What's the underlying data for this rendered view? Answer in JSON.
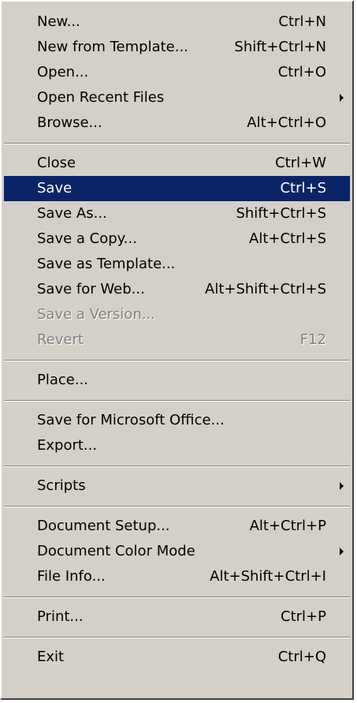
{
  "menu": {
    "groups": [
      [
        {
          "label": "New...",
          "shortcut": "Ctrl+N"
        },
        {
          "label": "New from Template...",
          "shortcut": "Shift+Ctrl+N"
        },
        {
          "label": "Open...",
          "shortcut": "Ctrl+O"
        },
        {
          "label": "Open Recent Files",
          "shortcut": "",
          "submenu": true
        },
        {
          "label": "Browse...",
          "shortcut": "Alt+Ctrl+O"
        }
      ],
      [
        {
          "label": "Close",
          "shortcut": "Ctrl+W"
        },
        {
          "label": "Save",
          "shortcut": "Ctrl+S",
          "selected": true
        },
        {
          "label": "Save As...",
          "shortcut": "Shift+Ctrl+S"
        },
        {
          "label": "Save a Copy...",
          "shortcut": "Alt+Ctrl+S"
        },
        {
          "label": "Save as Template...",
          "shortcut": ""
        },
        {
          "label": "Save for Web...",
          "shortcut": "Alt+Shift+Ctrl+S"
        },
        {
          "label": "Save a Version...",
          "shortcut": "",
          "disabled": true
        },
        {
          "label": "Revert",
          "shortcut": "F12",
          "disabled": true
        }
      ],
      [
        {
          "label": "Place...",
          "shortcut": ""
        }
      ],
      [
        {
          "label": "Save for Microsoft Office...",
          "shortcut": ""
        },
        {
          "label": "Export...",
          "shortcut": ""
        }
      ],
      [
        {
          "label": "Scripts",
          "shortcut": "",
          "submenu": true
        }
      ],
      [
        {
          "label": "Document Setup...",
          "shortcut": "Alt+Ctrl+P"
        },
        {
          "label": "Document Color Mode",
          "shortcut": "",
          "submenu": true
        },
        {
          "label": "File Info...",
          "shortcut": "Alt+Shift+Ctrl+I"
        }
      ],
      [
        {
          "label": "Print...",
          "shortcut": "Ctrl+P"
        }
      ],
      [
        {
          "label": "Exit",
          "shortcut": "Ctrl+Q"
        }
      ]
    ],
    "colors": {
      "background": "#d4d0c8",
      "selected_background": "#0a246a",
      "selected_text": "#ffffff",
      "disabled_text": "#808080"
    }
  }
}
